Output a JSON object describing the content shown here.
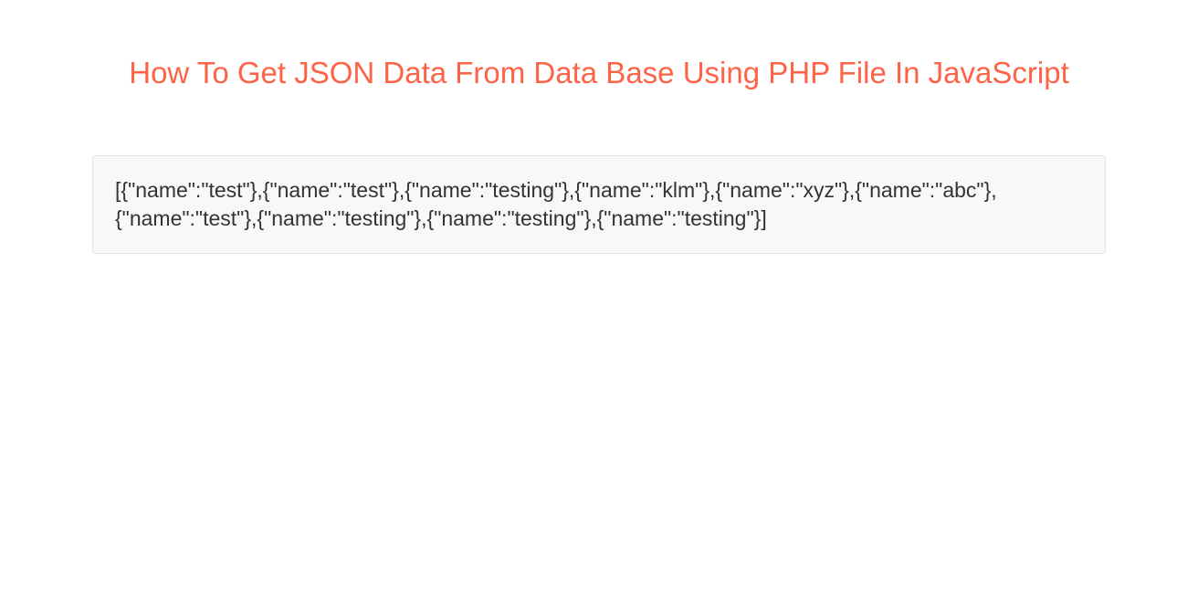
{
  "header": {
    "title": "How To Get JSON Data From Data Base Using PHP File In JavaScript"
  },
  "output": {
    "json_text": "[{\"name\":\"test\"},{\"name\":\"test\"},{\"name\":\"testing\"},{\"name\":\"klm\"},{\"name\":\"xyz\"},{\"name\":\"abc\"},{\"name\":\"test\"},{\"name\":\"testing\"},{\"name\":\"testing\"},{\"name\":\"testing\"}]"
  }
}
